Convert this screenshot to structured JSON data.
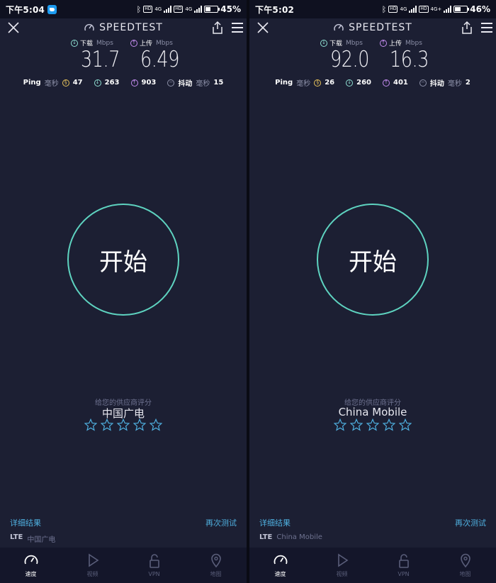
{
  "app_title": "SPEEDTEST",
  "labels": {
    "download": "下载",
    "upload": "上传",
    "unit_mbps": "Mbps",
    "ping": "Ping",
    "ms": "毫秒",
    "jitter": "抖动",
    "go": "开始",
    "rate_hint": "给您的供应商评分",
    "details": "详细结果",
    "again": "再次测试",
    "lte": "LTE"
  },
  "nav": [
    "速度",
    "视频",
    "VPN",
    "地图"
  ],
  "colors": {
    "background": "#1c1f33",
    "accent_teal": "#5ed3c0",
    "download": "#8fe0d3",
    "upload": "#c48cf0",
    "ping": "#e8c35b",
    "link": "#4fb0e0"
  },
  "left": {
    "status": {
      "time": "下午5:04",
      "battery": "45%",
      "battery_level": 0.45
    },
    "download": "31.7",
    "upload": "6.49",
    "ping": "47",
    "ping_down": "263",
    "ping_up": "903",
    "jitter": "15",
    "provider": "中国广电",
    "rating_stars": 5
  },
  "right": {
    "status": {
      "time": "下午5:02",
      "battery": "46%",
      "battery_level": 0.46
    },
    "download": "92.0",
    "upload": "16.3",
    "ping": "26",
    "ping_down": "260",
    "ping_up": "401",
    "jitter": "2",
    "provider": "China Mobile",
    "rating_stars": 5
  },
  "icons": [
    "twitter-icon",
    "bluetooth-icon",
    "signal-icon",
    "battery-icon",
    "close-icon",
    "speedtest-logo-icon",
    "share-icon",
    "menu-icon",
    "download-arrow-icon",
    "upload-arrow-icon",
    "ping-icon",
    "jitter-icon",
    "star-icon",
    "speed-icon",
    "video-icon",
    "vpn-lock-icon",
    "map-pin-icon"
  ]
}
